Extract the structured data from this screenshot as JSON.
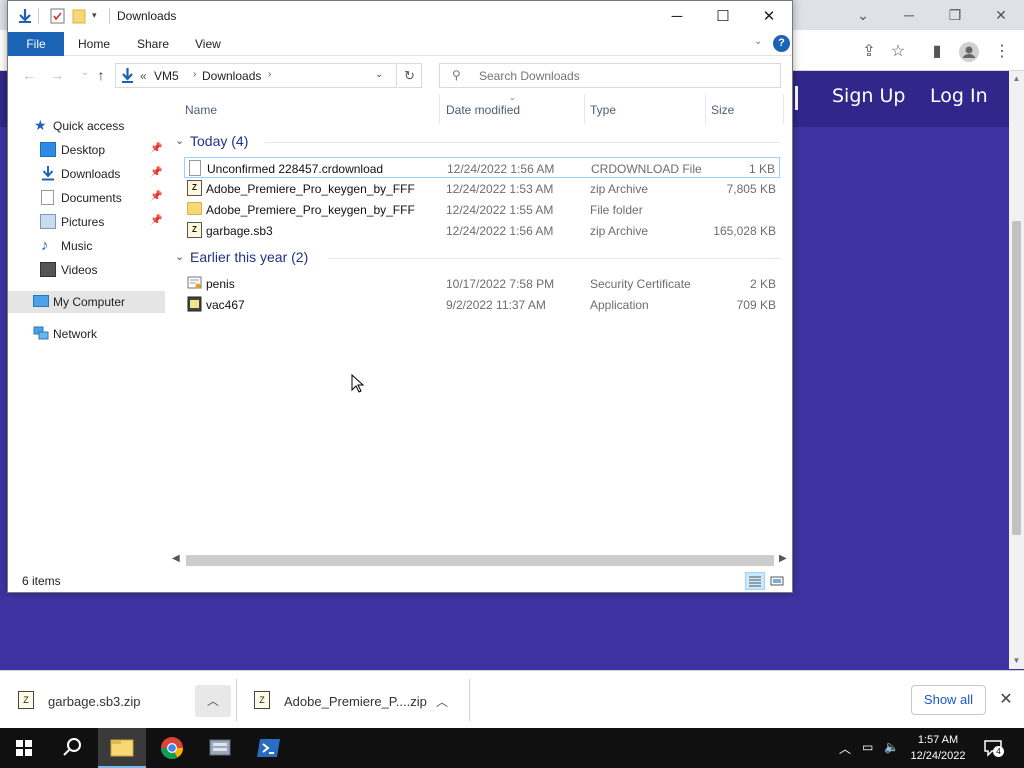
{
  "browser": {
    "nav_links": [
      "Sign Up",
      "Log In"
    ],
    "downloads_shelf": {
      "items": [
        {
          "filename": "garbage.sb3.zip"
        },
        {
          "filename": "Adobe_Premiere_P....zip"
        }
      ],
      "show_all_label": "Show all"
    }
  },
  "explorer": {
    "title": "Downloads",
    "ribbon_tabs": [
      "File",
      "Home",
      "Share",
      "View"
    ],
    "breadcrumb": {
      "prefix": "«",
      "items": [
        "VM5",
        "Downloads"
      ]
    },
    "search_placeholder": "Search Downloads",
    "nav_pane": [
      {
        "label": "Quick access",
        "pinned": false
      },
      {
        "label": "Desktop",
        "pinned": true
      },
      {
        "label": "Downloads",
        "pinned": true
      },
      {
        "label": "Documents",
        "pinned": true
      },
      {
        "label": "Pictures",
        "pinned": true
      },
      {
        "label": "Music",
        "pinned": false
      },
      {
        "label": "Videos",
        "pinned": false
      },
      {
        "label": "My Computer",
        "pinned": false,
        "selected": true
      },
      {
        "label": "Network",
        "pinned": false
      }
    ],
    "columns": [
      "Name",
      "Date modified",
      "Type",
      "Size"
    ],
    "groups": [
      {
        "label": "Today (4)",
        "files": [
          {
            "name": "Unconfirmed 228457.crdownload",
            "date": "12/24/2022 1:56 AM",
            "type": "CRDOWNLOAD File",
            "size": "1 KB",
            "icon": "document-icon"
          },
          {
            "name": "Adobe_Premiere_Pro_keygen_by_FFF",
            "date": "12/24/2022 1:53 AM",
            "type": "zip Archive",
            "size": "7,805 KB",
            "icon": "zip-icon"
          },
          {
            "name": "Adobe_Premiere_Pro_keygen_by_FFF",
            "date": "12/24/2022 1:55 AM",
            "type": "File folder",
            "size": "",
            "icon": "folder-icon"
          },
          {
            "name": "garbage.sb3",
            "date": "12/24/2022 1:56 AM",
            "type": "zip Archive",
            "size": "165,028 KB",
            "icon": "zip-icon"
          }
        ]
      },
      {
        "label": "Earlier this year (2)",
        "files": [
          {
            "name": "penis",
            "date": "10/17/2022 7:58 PM",
            "type": "Security Certificate",
            "size": "2 KB",
            "icon": "certificate-icon"
          },
          {
            "name": "vac467",
            "date": "9/2/2022 11:37 AM",
            "type": "Application",
            "size": "709 KB",
            "icon": "application-icon"
          }
        ]
      }
    ],
    "status": "6 items"
  },
  "taskbar": {
    "time": "1:57 AM",
    "date": "12/24/2022",
    "notification_count": "4"
  },
  "colors": {
    "site_background": "#3f33a3",
    "site_header": "#31278a",
    "ribbon_file_tab": "#1a63b5",
    "group_header_text": "#1e3287"
  }
}
